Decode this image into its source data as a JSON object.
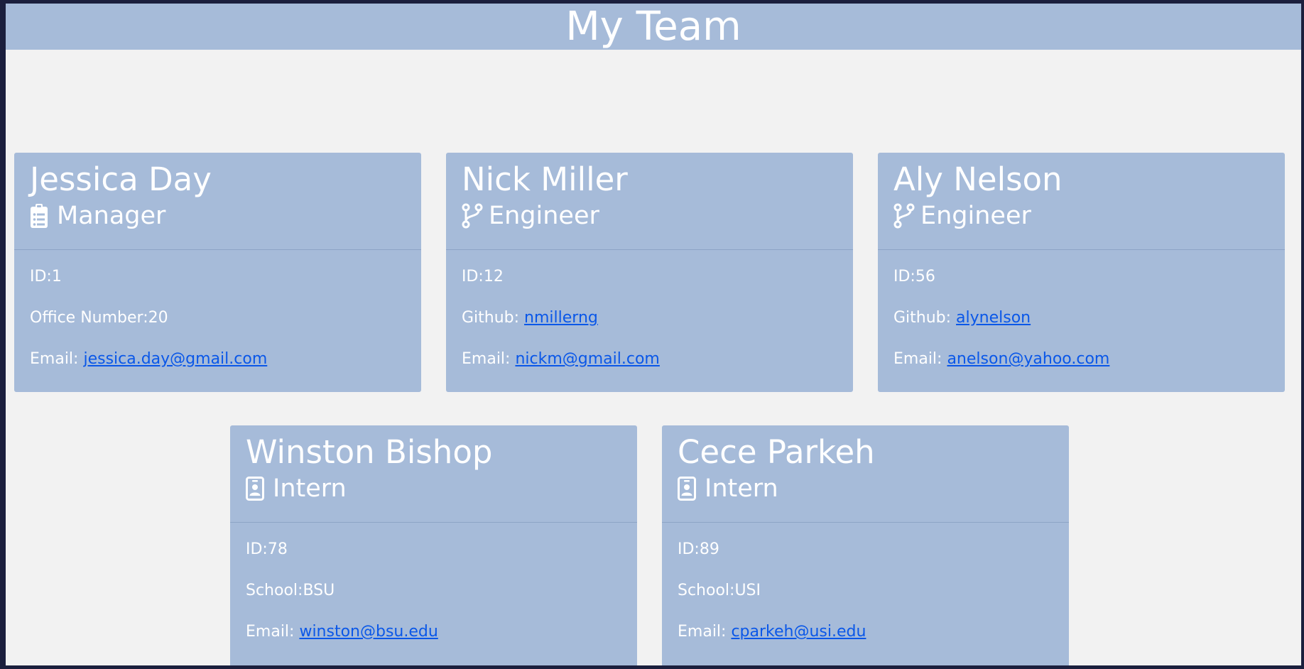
{
  "header": {
    "title": "My Team"
  },
  "labels": {
    "id": "ID:",
    "office": "Office Number:",
    "github": "Github: ",
    "school": "School:",
    "email": "Email: "
  },
  "colors": {
    "card_bg": "#a6bbd9",
    "page_bg": "#f2f2f2",
    "link": "#0a57e8"
  },
  "employees": [
    {
      "name": "Jessica Day",
      "role": "Manager",
      "icon": "clipboard-list-icon",
      "id": "1",
      "extra_value": "20",
      "email": "jessica.day@gmail.com"
    },
    {
      "name": "Nick Miller",
      "role": "Engineer",
      "icon": "code-branch-icon",
      "id": "12",
      "extra_value": "nmillerng",
      "email": "nickm@gmail.com"
    },
    {
      "name": "Aly Nelson",
      "role": "Engineer",
      "icon": "code-branch-icon",
      "id": "56",
      "extra_value": "alynelson",
      "email": "anelson@yahoo.com"
    },
    {
      "name": "Winston Bishop",
      "role": "Intern",
      "icon": "id-badge-icon",
      "id": "78",
      "extra_value": "BSU",
      "email": "winston@bsu.edu"
    },
    {
      "name": "Cece Parkeh",
      "role": "Intern",
      "icon": "id-badge-icon",
      "id": "89",
      "extra_value": "USI",
      "email": "cparkeh@usi.edu"
    }
  ]
}
